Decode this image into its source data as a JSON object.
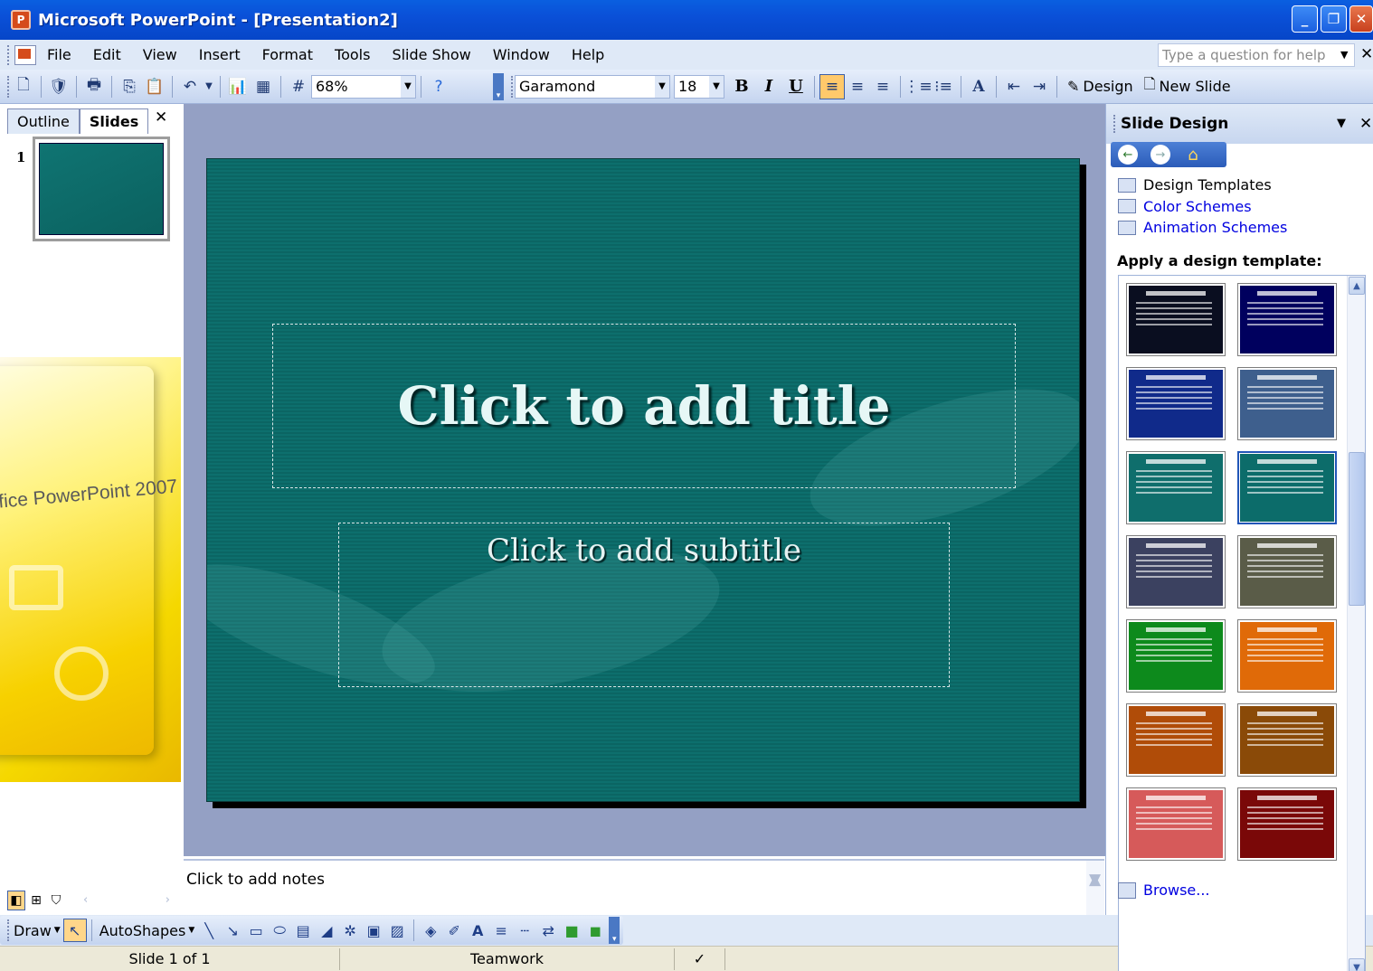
{
  "window": {
    "title": "Microsoft PowerPoint - [Presentation2]",
    "controls": [
      "_",
      "❐",
      "✕"
    ]
  },
  "background": {
    "box_text": "fice PowerPoint 2007"
  },
  "menu": {
    "items": [
      "File",
      "Edit",
      "View",
      "Insert",
      "Format",
      "Tools",
      "Slide Show",
      "Window",
      "Help"
    ],
    "help_placeholder": "Type a question for help"
  },
  "toolbar": {
    "zoom": "68%",
    "font": "Garamond",
    "font_size": "18",
    "bold": "B",
    "italic": "I",
    "underline": "U",
    "design_label": "Design",
    "new_slide_label": "New Slide"
  },
  "left_pane": {
    "tabs": [
      "Outline",
      "Slides"
    ],
    "active_tab": "Slides",
    "slide_number": "1"
  },
  "slide": {
    "title_placeholder": "Click to add title",
    "subtitle_placeholder": "Click to add subtitle"
  },
  "notes": {
    "placeholder": "Click to add notes"
  },
  "draw_toolbar": {
    "draw_label": "Draw",
    "autoshapes_label": "AutoShapes"
  },
  "status": {
    "slide_info": "Slide 1 of 1",
    "design_name": "Teamwork"
  },
  "task_pane": {
    "title": "Slide Design",
    "links": [
      {
        "label": "Design Templates",
        "style": "plain"
      },
      {
        "label": "Color Schemes",
        "style": "link"
      },
      {
        "label": "Animation Schemes",
        "style": "link"
      }
    ],
    "apply_label": "Apply a design template:",
    "browse_label": "Browse...",
    "template_colors": [
      "#0a0e20",
      "#00005e",
      "#102a8a",
      "#3e5f8d",
      "#0f6e6c",
      "#0c6c6a",
      "#3b4160",
      "#5a5c48",
      "#0d8a1c",
      "#e06a08",
      "#b04c08",
      "#8a4a08",
      "#d65a5a",
      "#7a0808"
    ],
    "selected_template_index": 5
  }
}
